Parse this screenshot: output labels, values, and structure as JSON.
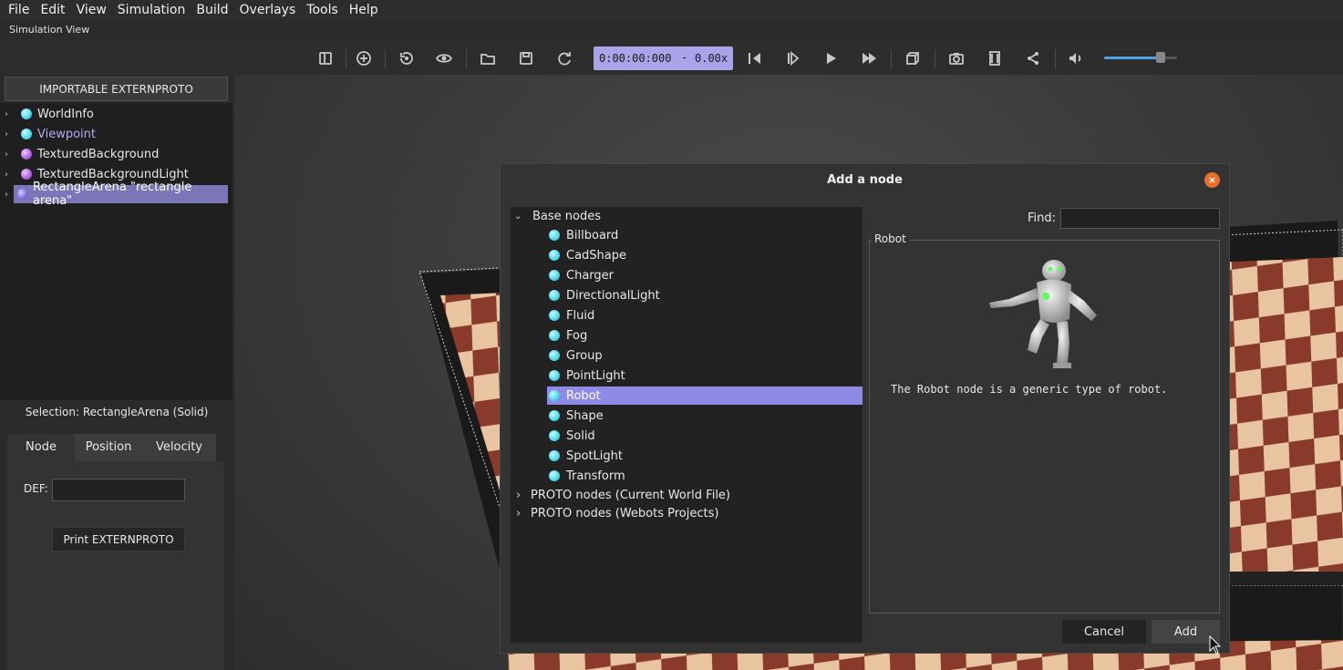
{
  "menu": [
    "File",
    "Edit",
    "View",
    "Simulation",
    "Build",
    "Overlays",
    "Tools",
    "Help"
  ],
  "window_subtitle": "Simulation View",
  "toolbar": {
    "time": "0:00:00:000",
    "dash": "-",
    "speed": "0.00x",
    "volume_level": 0.78,
    "accent_color": "#a9a4ea"
  },
  "left_panel": {
    "importable_label": "IMPORTABLE EXTERNPROTO",
    "scene_tree": [
      {
        "label": "WorldInfo",
        "icon": "cyan-node-icon"
      },
      {
        "label": "Viewpoint",
        "icon": "cyan-node-icon",
        "color": "#b8a8ff"
      },
      {
        "label": "TexturedBackground",
        "icon": "purple-node-icon"
      },
      {
        "label": "TexturedBackgroundLight",
        "icon": "purple-node-icon"
      },
      {
        "label": "RectangleArena \"rectangle arena\"",
        "icon": "violet-node-icon",
        "selected": true
      }
    ],
    "selection_text": "Selection: RectangleArena (Solid)",
    "tabs": [
      "Node",
      "Position",
      "Velocity"
    ],
    "def_label": "DEF:",
    "def_value": "",
    "print_button": "Print EXTERNPROTO"
  },
  "dialog": {
    "title": "Add a node",
    "tree": {
      "base_label": "Base nodes",
      "base_nodes": [
        "Billboard",
        "CadShape",
        "Charger",
        "DirectionalLight",
        "Fluid",
        "Fog",
        "Group",
        "PointLight",
        "Robot",
        "Shape",
        "Solid",
        "SpotLight",
        "Transform"
      ],
      "selected": "Robot",
      "proto_current": "PROTO nodes (Current World File)",
      "proto_webots": "PROTO nodes (Webots Projects)"
    },
    "find_label": "Find:",
    "find_value": "",
    "preview_title": "Robot",
    "description": "The Robot node is a generic type of robot.",
    "cancel_label": "Cancel",
    "add_label": "Add"
  }
}
